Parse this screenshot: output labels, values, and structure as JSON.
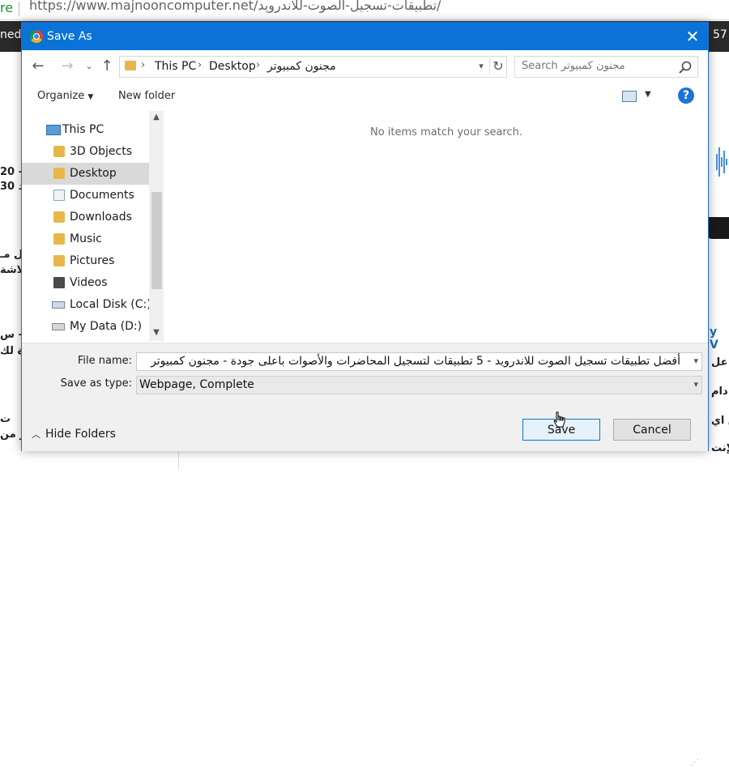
{
  "browser": {
    "url_prefix": "re",
    "url": "https://www.majnooncomputer.net/تطبيقات-تسجيل-الصوت-للاندرويد/",
    "tab_left_text": "ned",
    "tab_right_text": "57"
  },
  "background_page": {
    "left_snippets": [
      "20 –",
      "30 د",
      "ل مـ",
      "لاشة",
      "س –",
      "ة لك",
      "ت",
      "ر من"
    ],
    "right_link": "y V",
    "right_snippets": [
      "ي عل",
      "دام",
      "ق اي",
      "الإنت"
    ]
  },
  "dialog": {
    "title": "Save As",
    "nav": {
      "back_icon": "arrow-left-icon",
      "forward_icon": "arrow-right-icon",
      "recent_icon": "chevron-down-icon",
      "up_icon": "arrow-up-icon"
    },
    "breadcrumb": [
      "This PC",
      "Desktop",
      "مجنون كمبيوتر"
    ],
    "search_placeholder": "Search مجنون كمبيوتر",
    "toolbar": {
      "organize": "Organize",
      "new_folder": "New folder"
    },
    "nav_pane": [
      {
        "label": "This PC",
        "icon": "computer-icon"
      },
      {
        "label": "3D Objects",
        "icon": "folder-3d-icon"
      },
      {
        "label": "Desktop",
        "icon": "desktop-folder-icon",
        "selected": true
      },
      {
        "label": "Documents",
        "icon": "documents-icon"
      },
      {
        "label": "Downloads",
        "icon": "downloads-icon"
      },
      {
        "label": "Music",
        "icon": "music-icon"
      },
      {
        "label": "Pictures",
        "icon": "pictures-icon"
      },
      {
        "label": "Videos",
        "icon": "videos-icon"
      },
      {
        "label": "Local Disk (C:)",
        "icon": "local-disk-icon"
      },
      {
        "label": "My Data (D:)",
        "icon": "drive-icon"
      }
    ],
    "empty_message": "No items match your search.",
    "file_name_label": "File name:",
    "file_name_value": "أفضل تطبيقات تسجيل الصوت للاندرويد - 5 تطبيقات لتسجيل المحاضرات والأصوات باعلى جودة - مجنون كمبيوتر",
    "save_type_label": "Save as type:",
    "save_type_value": "Webpage, Complete",
    "hide_folders": "Hide Folders",
    "save_button": "Save",
    "cancel_button": "Cancel",
    "accent_color": "#0b73d8"
  }
}
